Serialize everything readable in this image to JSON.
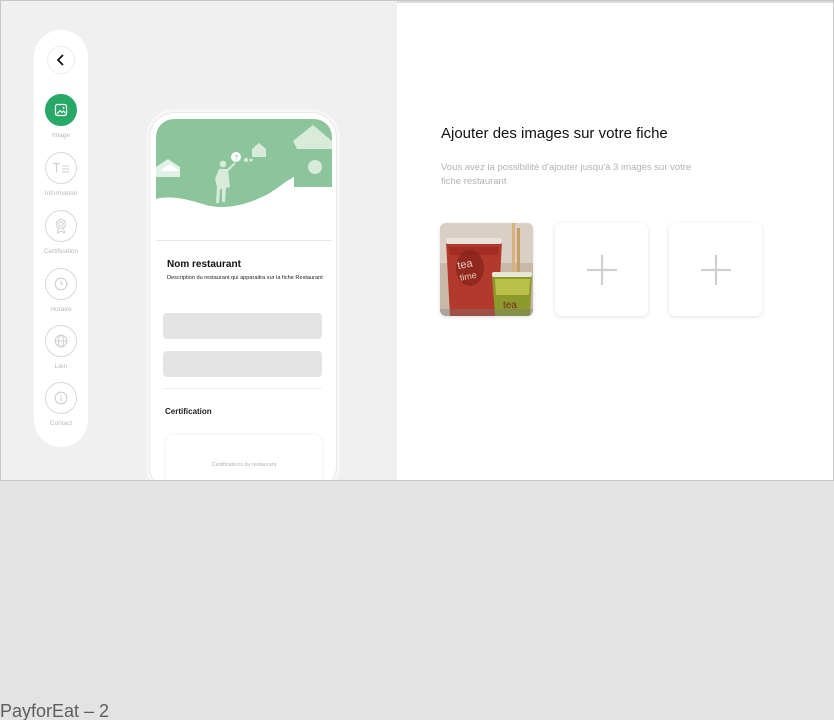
{
  "sidebar": {
    "back_icon": "chevron-left-icon",
    "items": [
      {
        "label": "Image",
        "icon": "image-icon",
        "active": true
      },
      {
        "label": "Information",
        "icon": "text-icon",
        "active": false
      },
      {
        "label": "Certification",
        "icon": "badge-icon",
        "active": false
      },
      {
        "label": "Horaire",
        "icon": "clock-icon",
        "active": false
      },
      {
        "label": "Lien",
        "icon": "globe-icon",
        "active": false
      },
      {
        "label": "Contact",
        "icon": "info-icon",
        "active": false
      }
    ]
  },
  "preview": {
    "restaurant_name": "Nom restaurant",
    "description": "Description du restaurant qui apparaitra sur la fiche Restaurant",
    "certification_title": "Certification",
    "certification_placeholder": "Certifications du restaurant"
  },
  "panel": {
    "title": "Ajouter des images sur votre fiche",
    "subtitle": "Vous avez la possibilité d'ajouter jusqu'à 3 images sur votre fiche restaurant",
    "slots": [
      {
        "state": "filled",
        "icon": "photo-thumbnail"
      },
      {
        "state": "empty",
        "icon": "plus-icon"
      },
      {
        "state": "empty",
        "icon": "plus-icon"
      }
    ]
  },
  "colors": {
    "accent": "#27a866",
    "hero_green": "#8cc59b",
    "plus": "#cfcfcf"
  },
  "footer": {
    "caption": "PayforEat – 2"
  }
}
